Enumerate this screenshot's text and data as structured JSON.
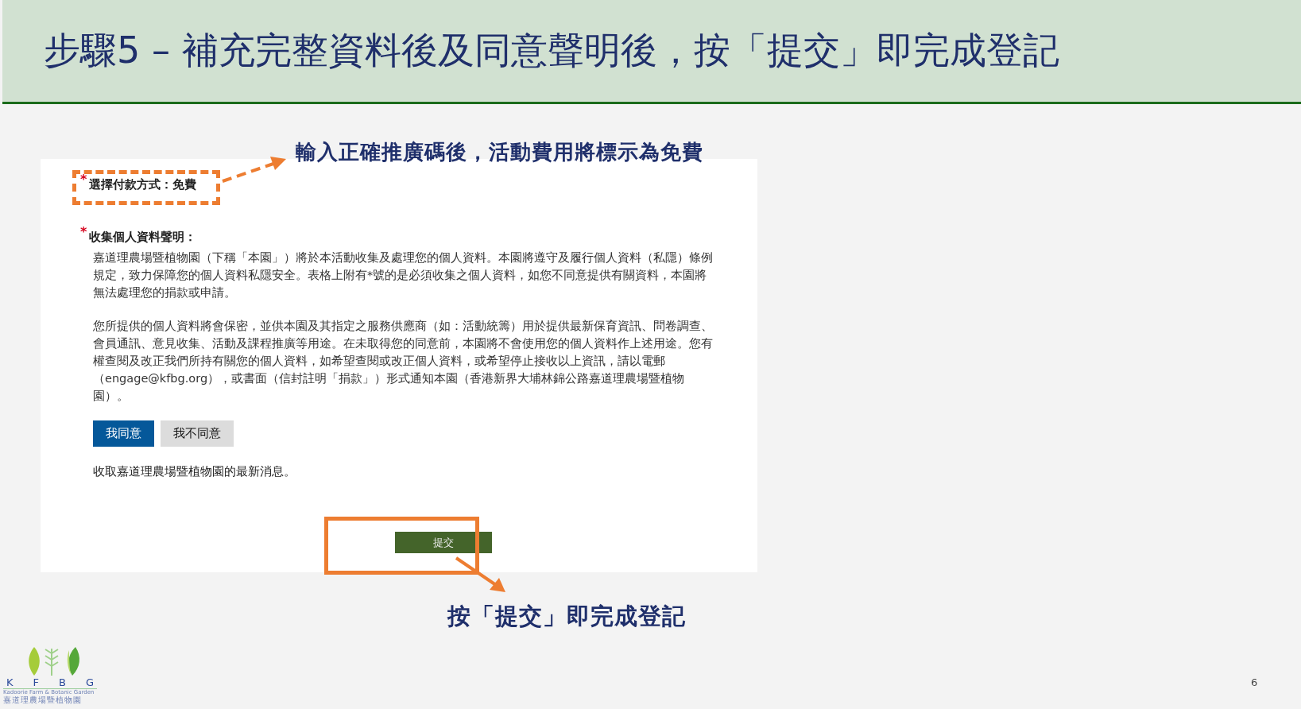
{
  "slide": {
    "title": "步驟5 – 補充完整資料後及同意聲明後，按「提交」即完成登記",
    "page_number": "6"
  },
  "annotations": {
    "top_callout": "輸入正確推廣碼後，活動費用將標示為免費",
    "bottom_callout": "按「提交」即完成登記"
  },
  "form": {
    "payment": {
      "label": "選擇付款方式：免費",
      "required_mark": "*"
    },
    "statement": {
      "heading": "收集個人資料聲明：",
      "required_mark": "*",
      "paragraphs": [
        "嘉道理農場暨植物園（下稱「本園」）將於本活動收集及處理您的個人資料。本園將遵守及履行個人資料（私隱）條例規定，致力保障您的個人資料私隱安全。表格上附有*號的是必須收集之個人資料，如您不同意提供有關資料，本園將無法處理您的捐款或申請。",
        "您所提供的個人資料將會保密，並供本園及其指定之服務供應商（如：活動統籌）用於提供最新保育資訊、問卷調查、會員通訊、意見收集、活動及課程推廣等用途。在未取得您的同意前，本園將不會使用您的個人資料作上述用途。您有權查閱及改正我們所持有關您的個人資料，如希望查閱或改正個人資料，或希望停止接收以上資訊，請以電郵（engage@kfbg.org），或書面（信封註明「捐款」）形式通知本園（香港新界大埔林錦公路嘉道理農場暨植物園）。"
      ]
    },
    "consent_buttons": [
      {
        "label": "我同意",
        "selected": true
      },
      {
        "label": "我不同意",
        "selected": false
      }
    ],
    "newsletter": "收取嘉道理農場暨植物園的最新消息。",
    "submit": "提交"
  },
  "logo": {
    "letters": [
      "K",
      "F",
      "B",
      "G"
    ],
    "english": "Kadoorie Farm & Botanic Garden",
    "chinese": "嘉道理農場暨植物園"
  }
}
